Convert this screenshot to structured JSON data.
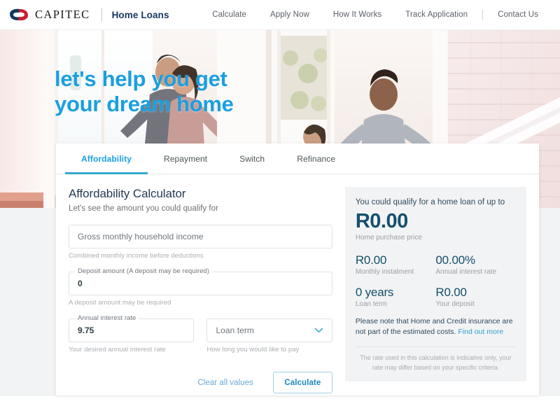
{
  "header": {
    "logo_text": "CAPITEC",
    "logo_icon": "capitec-logo-icon",
    "section_title": "Home Loans",
    "nav": [
      {
        "label": "Calculate"
      },
      {
        "label": "Apply Now"
      },
      {
        "label": "How It Works"
      },
      {
        "label": "Track Application"
      },
      {
        "label": "Contact Us"
      }
    ]
  },
  "hero": {
    "title_line1": "let's help you get",
    "title_line2": "your dream home",
    "accent_color": "#1a9fe0"
  },
  "tabs": [
    {
      "label": "Affordability",
      "active": true
    },
    {
      "label": "Repayment",
      "active": false
    },
    {
      "label": "Switch",
      "active": false
    },
    {
      "label": "Refinance",
      "active": false
    }
  ],
  "calculator": {
    "title": "Affordability Calculator",
    "subtitle": "Let's see the amount you could qualify for",
    "fields": {
      "income": {
        "placeholder": "Gross monthly household income",
        "value": "",
        "hint": "Combined monthly income before deductions"
      },
      "deposit": {
        "label": "Deposit amount (A deposit may be required)",
        "value": "0",
        "hint": "A deposit amount may be required"
      },
      "interest": {
        "label": "Annual interest rate",
        "value": "9.75",
        "hint": "Your desired annual interest rate"
      },
      "term": {
        "placeholder": "Loan term",
        "value": "",
        "hint": "How long you would like to pay",
        "icon": "chevron-down-icon"
      }
    },
    "actions": {
      "clear_label": "Clear all values",
      "calculate_label": "Calculate"
    }
  },
  "results": {
    "lead": "You could qualify for a home loan of up to",
    "headline_value": "R0.00",
    "headline_caption": "Home purchase price",
    "metrics": [
      {
        "value": "R0.00",
        "caption": "Monthly instalment"
      },
      {
        "value": "00.00%",
        "caption": "Annual interest rate"
      },
      {
        "value": "0 years",
        "caption": "Loan term"
      },
      {
        "value": "R0.00",
        "caption": "Your deposit"
      }
    ],
    "note_text": "Please note that Home and Credit insurance are not part of the estimated costs. ",
    "note_link": "Find out more",
    "disclaimer": "The rate used in this calculation is indicative only, your rate may differ based on your specific criteria."
  },
  "colors": {
    "brand_blue": "#1a9fe0",
    "navy": "#15506e",
    "logo_navy": "#123a63",
    "logo_red": "#c8202f",
    "panel_bg": "#f2f3f4"
  }
}
